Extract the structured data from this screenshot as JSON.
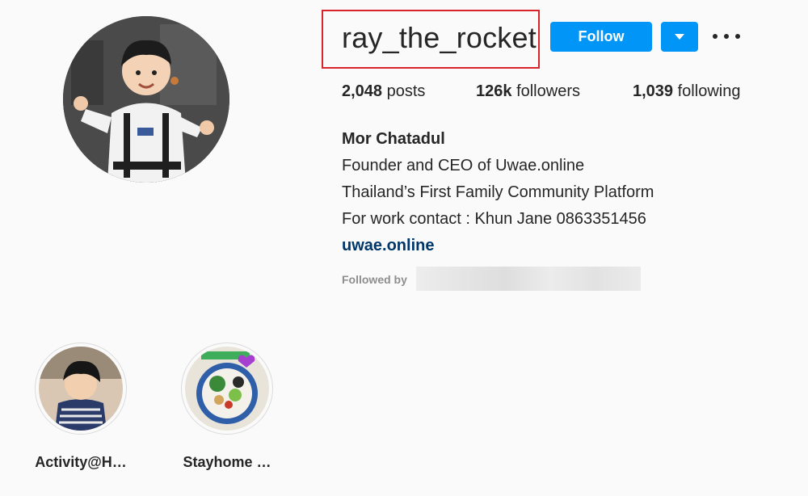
{
  "profile": {
    "username": "ray_the_rocket",
    "follow_label": "Follow",
    "stats": {
      "posts_count": "2,048",
      "posts_label": "posts",
      "followers_count": "126k",
      "followers_label": "followers",
      "following_count": "1,039",
      "following_label": "following"
    },
    "bio": {
      "name": "Mor Chatadul",
      "lines": [
        "Founder and CEO of Uwae.online",
        "Thailand’s First Family Community Platform",
        "For work contact : Khun Jane 0863351456"
      ],
      "link": "uwae.online"
    },
    "followed_by_label": "Followed by"
  },
  "highlights": [
    {
      "label": "Activity@H…"
    },
    {
      "label": "Stayhome …"
    }
  ],
  "colors": {
    "primary_button": "#0095f6",
    "link": "#00376b",
    "highlight_box": "#d9242b",
    "background": "#fafafa"
  },
  "icons": [
    "caret-down-icon",
    "more-options-icon"
  ]
}
